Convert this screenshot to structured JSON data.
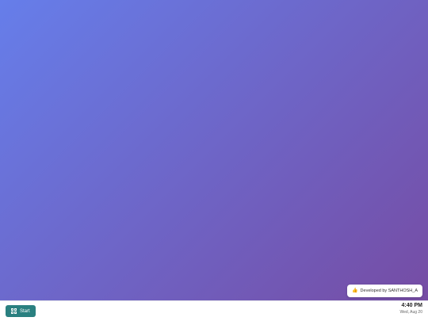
{
  "desktop": {
    "credit": {
      "icon": "thumbs-up-icon",
      "icon_glyph": "👍",
      "text": "Developed by SANTHOSH_A"
    }
  },
  "taskbar": {
    "start": {
      "icon": "grid-icon",
      "label": "Start",
      "color": "#2a8080"
    },
    "clock": {
      "time": "4:40 PM",
      "date": "Wed, Aug 20"
    }
  },
  "colors": {
    "gradient_start": "#667eea",
    "gradient_end": "#764ba2",
    "taskbar_bg": "#ffffff"
  }
}
